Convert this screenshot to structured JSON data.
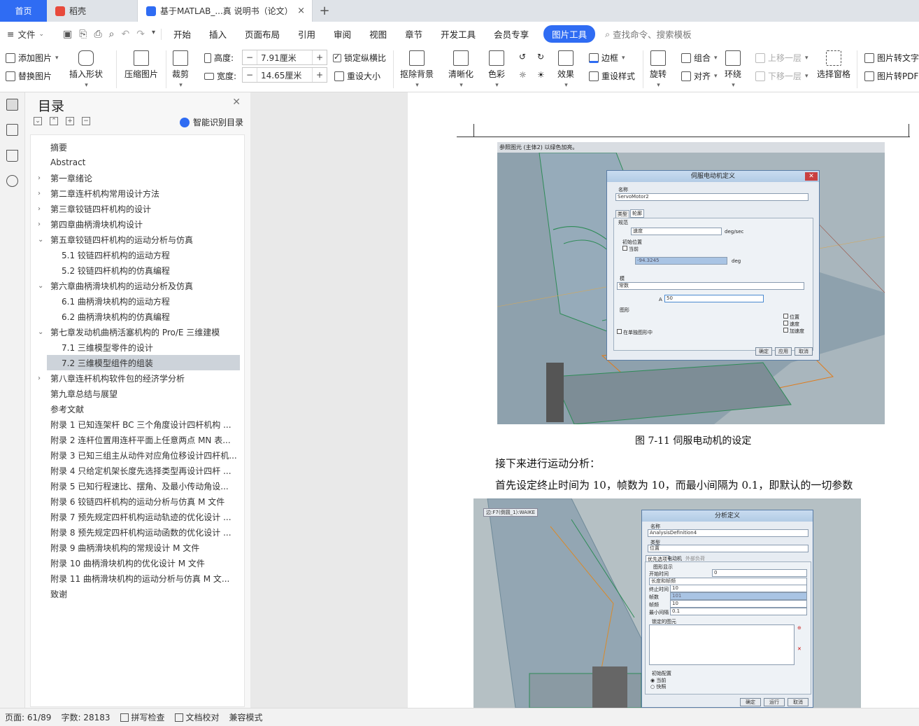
{
  "tabs": {
    "home": "首页",
    "daoke": "稻壳",
    "doc": "基于MATLAB_...真 说明书（论文）",
    "close": "×",
    "add": "+"
  },
  "menu": {
    "file": "文件",
    "items": [
      "开始",
      "插入",
      "页面布局",
      "引用",
      "审阅",
      "视图",
      "章节",
      "开发工具",
      "会员专享"
    ],
    "picture_tools": "图片工具",
    "search": "查找命令、搜索模板"
  },
  "ribbon": {
    "add_picture": "添加图片",
    "replace_picture": "替换图片",
    "insert_shape": "插入形状",
    "compress": "压缩图片",
    "crop": "裁剪",
    "height_label": "高度:",
    "height_value": "7.91厘米",
    "width_label": "宽度:",
    "width_value": "14.65厘米",
    "lock_ratio": "锁定纵横比",
    "reset_size": "重设大小",
    "remove_bg": "抠除背景",
    "sharpen": "清晰化",
    "color": "色彩",
    "effects": "效果",
    "border": "边框",
    "reset_style": "重设样式",
    "rotate": "旋转",
    "group": "组合",
    "align": "对齐",
    "wrap": "环绕",
    "bring_forward": "上移一层",
    "send_backward": "下移一层",
    "select_pane": "选择窗格",
    "to_text": "图片转文字",
    "to_pdf": "图片转PDF"
  },
  "toc": {
    "title": "目录",
    "smart": "智能识别目录",
    "items": [
      {
        "label": "摘要",
        "level": 0,
        "arrow": ""
      },
      {
        "label": "Abstract",
        "level": 0,
        "arrow": ""
      },
      {
        "label": "第一章绪论",
        "level": 0,
        "arrow": "›"
      },
      {
        "label": "第二章连杆机构常用设计方法",
        "level": 0,
        "arrow": "›"
      },
      {
        "label": "第三章铰链四杆机构的设计",
        "level": 0,
        "arrow": "›"
      },
      {
        "label": "第四章曲柄滑块机构设计",
        "level": 0,
        "arrow": "›"
      },
      {
        "label": "第五章铰链四杆机构的运动分析与仿真",
        "level": 0,
        "arrow": "⌄"
      },
      {
        "label": "5.1  铰链四杆机构的运动方程",
        "level": 1,
        "arrow": ""
      },
      {
        "label": "5.2 铰链四杆机构的仿真编程",
        "level": 1,
        "arrow": ""
      },
      {
        "label": "第六章曲柄滑块机构的运动分析及仿真",
        "level": 0,
        "arrow": "⌄"
      },
      {
        "label": "6.1  曲柄滑块机构的运动方程",
        "level": 1,
        "arrow": ""
      },
      {
        "label": "6.2 曲柄滑块机构的仿真编程",
        "level": 1,
        "arrow": ""
      },
      {
        "label": "第七章发动机曲柄活塞机构的 Pro/E 三维建模",
        "level": 0,
        "arrow": "⌄"
      },
      {
        "label": "7.1  三维模型零件的设计",
        "level": 1,
        "arrow": ""
      },
      {
        "label": "7.2 三维模型组件的组装",
        "level": 1,
        "arrow": "",
        "selected": true
      },
      {
        "label": "第八章连杆机构软件包的经济学分析",
        "level": 0,
        "arrow": "›"
      },
      {
        "label": "第九章总结与展望",
        "level": 0,
        "arrow": ""
      },
      {
        "label": "参考文献",
        "level": 0,
        "arrow": ""
      },
      {
        "label": "附录 1  已知连架杆 BC 三个角度设计四杆机构 ...",
        "level": 0,
        "arrow": ""
      },
      {
        "label": "附录 2  连杆位置用连杆平面上任意两点 MN 表...",
        "level": 0,
        "arrow": ""
      },
      {
        "label": "附录 3 已知三组主从动件对应角位移设计四杆机...",
        "level": 0,
        "arrow": ""
      },
      {
        "label": "附录 4  只给定机架长度先选择类型再设计四杆 ...",
        "level": 0,
        "arrow": ""
      },
      {
        "label": "附录 5  已知行程速比、摆角、及最小传动角设...",
        "level": 0,
        "arrow": ""
      },
      {
        "label": "附录 6  铰链四杆机构的运动分析与仿真 M 文件",
        "level": 0,
        "arrow": ""
      },
      {
        "label": "附录 7  预先规定四杆机构运动轨迹的优化设计 ...",
        "level": 0,
        "arrow": ""
      },
      {
        "label": "附录 8  预先规定四杆机构运动函数的优化设计 ...",
        "level": 0,
        "arrow": ""
      },
      {
        "label": "附录 9  曲柄滑块机构的常规设计 M 文件",
        "level": 0,
        "arrow": ""
      },
      {
        "label": "附录 10  曲柄滑块机构的优化设计 M 文件",
        "level": 0,
        "arrow": ""
      },
      {
        "label": "附录 11  曲柄滑块机构的运动分析与仿真 M 文...",
        "level": 0,
        "arrow": ""
      },
      {
        "label": "致谢",
        "level": 0,
        "arrow": ""
      }
    ]
  },
  "document": {
    "fig1": {
      "info": "参照图元 (主体2) 以绿色加亮。",
      "dialog_title": "伺服电动机定义",
      "name_label": "名称",
      "name_value": "ServoMotor2",
      "tab_type": "类型",
      "tab_profile": "轮廓",
      "spec": "规范",
      "speed": "速度",
      "unit_speed": "deg/sec",
      "init_pos": "初始位置",
      "current": "当前",
      "init_value": "-94.3245",
      "unit_deg": "deg",
      "mode": "模",
      "constant": "常数",
      "a_label": "A",
      "a_value": "50",
      "graph": "图形",
      "single_graph": "在单独图形中",
      "opt_position": "位置",
      "opt_speed": "速度",
      "opt_accel": "加速度",
      "ok": "确定",
      "apply": "应用",
      "cancel": "取消"
    },
    "caption": "图 7-11  伺服电动机的设定",
    "para1": "接下来进行运动分析：",
    "para2": "首先设定终止时间为 10，帧数为 10，而最小间隔为 0.1，即默认的一切参数",
    "fig2": {
      "info": "边:F7(倒圆_1):WAIKE",
      "dialog_title": "分析定义",
      "name_label": "名称",
      "name_value": "AnalysisDefinition4",
      "type_label": "类型",
      "type_value": "位置",
      "tab_pref": "优先选项",
      "tab_motor": "电动机",
      "tab_ext": "外部负荷",
      "graph_disp": "图形显示",
      "start_time": "开始时间",
      "start_value": "0",
      "mode_value": "长度和帧频",
      "end_time": "终止时间",
      "end_value": "10",
      "frames": "帧数",
      "frames_value": "101",
      "frame_rate": "帧频",
      "rate_value": "10",
      "min_interval": "最小间隔",
      "min_value": "0.1",
      "locked": "锁定的图元",
      "init_config": "初始配置",
      "current": "当前",
      "snapshot": "快照",
      "ok": "确定",
      "run": "运行",
      "cancel": "取消"
    }
  },
  "status": {
    "page": "页面: 61/89",
    "words": "字数: 28183",
    "spell": "拼写检查",
    "proof": "文档校对",
    "compat": "兼容模式"
  },
  "colors": {
    "accent": "#2f6cf3",
    "toc_selected": "#cdd3da"
  }
}
